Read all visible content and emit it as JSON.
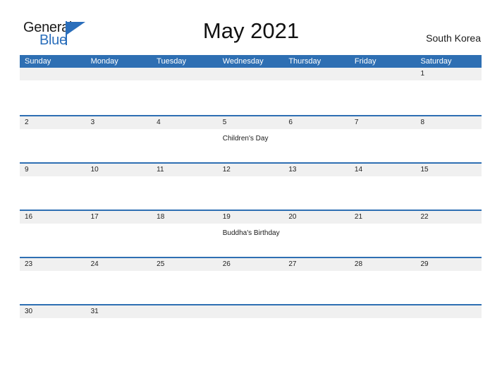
{
  "brand": {
    "name_part1": "General",
    "name_part2": "Blue",
    "accent_color": "#2a6ebb"
  },
  "header": {
    "title": "May 2021",
    "region": "South Korea"
  },
  "theme": {
    "header_blue": "#2e6fb3",
    "row_gray": "#f0f0f0",
    "rule_blue": "#2e6fb3"
  },
  "calendar": {
    "weekdays": [
      "Sunday",
      "Monday",
      "Tuesday",
      "Wednesday",
      "Thursday",
      "Friday",
      "Saturday"
    ],
    "weeks": [
      {
        "days": [
          {
            "num": "",
            "event": ""
          },
          {
            "num": "",
            "event": ""
          },
          {
            "num": "",
            "event": ""
          },
          {
            "num": "",
            "event": ""
          },
          {
            "num": "",
            "event": ""
          },
          {
            "num": "",
            "event": ""
          },
          {
            "num": "1",
            "event": ""
          }
        ]
      },
      {
        "days": [
          {
            "num": "2",
            "event": ""
          },
          {
            "num": "3",
            "event": ""
          },
          {
            "num": "4",
            "event": ""
          },
          {
            "num": "5",
            "event": "Children's Day"
          },
          {
            "num": "6",
            "event": ""
          },
          {
            "num": "7",
            "event": ""
          },
          {
            "num": "8",
            "event": ""
          }
        ]
      },
      {
        "days": [
          {
            "num": "9",
            "event": ""
          },
          {
            "num": "10",
            "event": ""
          },
          {
            "num": "11",
            "event": ""
          },
          {
            "num": "12",
            "event": ""
          },
          {
            "num": "13",
            "event": ""
          },
          {
            "num": "14",
            "event": ""
          },
          {
            "num": "15",
            "event": ""
          }
        ]
      },
      {
        "days": [
          {
            "num": "16",
            "event": ""
          },
          {
            "num": "17",
            "event": ""
          },
          {
            "num": "18",
            "event": ""
          },
          {
            "num": "19",
            "event": "Buddha's Birthday"
          },
          {
            "num": "20",
            "event": ""
          },
          {
            "num": "21",
            "event": ""
          },
          {
            "num": "22",
            "event": ""
          }
        ]
      },
      {
        "days": [
          {
            "num": "23",
            "event": ""
          },
          {
            "num": "24",
            "event": ""
          },
          {
            "num": "25",
            "event": ""
          },
          {
            "num": "26",
            "event": ""
          },
          {
            "num": "27",
            "event": ""
          },
          {
            "num": "28",
            "event": ""
          },
          {
            "num": "29",
            "event": ""
          }
        ]
      },
      {
        "days": [
          {
            "num": "30",
            "event": ""
          },
          {
            "num": "31",
            "event": ""
          },
          {
            "num": "",
            "event": ""
          },
          {
            "num": "",
            "event": ""
          },
          {
            "num": "",
            "event": ""
          },
          {
            "num": "",
            "event": ""
          },
          {
            "num": "",
            "event": ""
          }
        ]
      }
    ]
  }
}
